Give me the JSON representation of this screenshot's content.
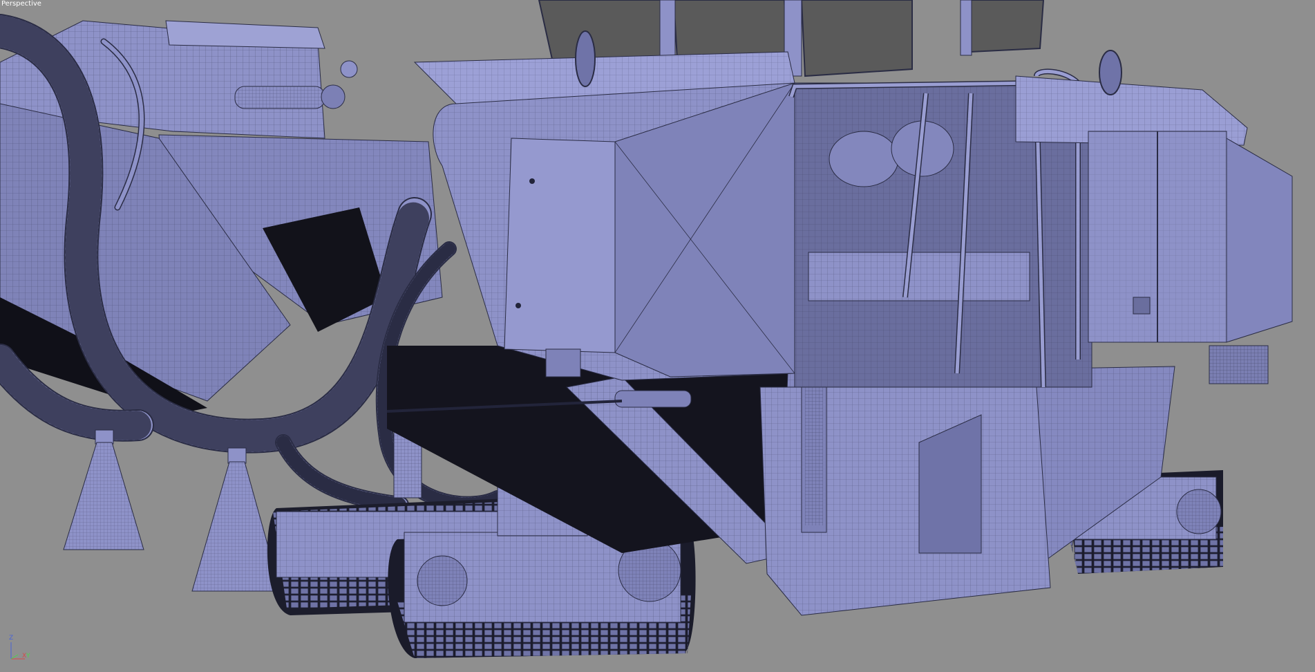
{
  "viewport": {
    "label": "Perspective",
    "background": "#8f8f8f",
    "model_color": "#8e92c8",
    "model_shadow": "#5d6196",
    "wire_color": "#2a2c44",
    "glass_color": "#5a5a5a"
  },
  "axis_gizmo": {
    "z_label": "Z",
    "x_label": "X",
    "y_label": "Y",
    "z_color": "#4a63d6",
    "x_color": "#d64a4a",
    "y_color": "#4ad64a"
  }
}
